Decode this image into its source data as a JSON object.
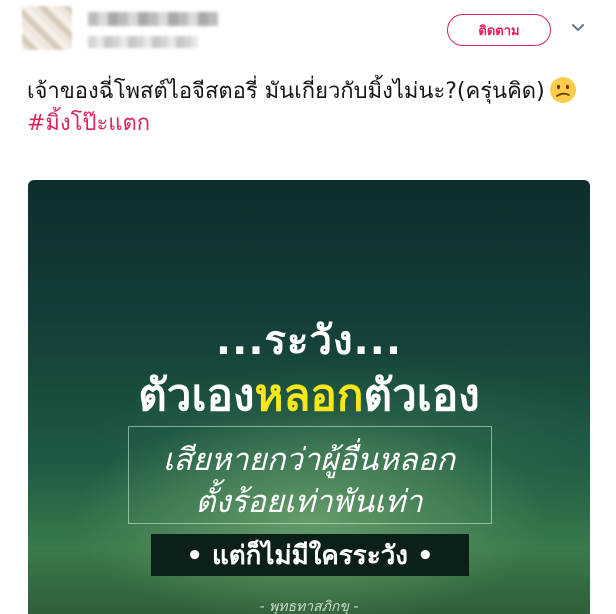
{
  "header": {
    "follow_label": "ติดตาม",
    "more_icon": "chevron-down-icon"
  },
  "tweet": {
    "text": "เจ้าของฉี่โพสต์ไอจีสตอรี่ มันเกี่ยวกับมิ้งไม่นะ?(ครุ่นคิด)",
    "emoji": "confused-face-emoji",
    "hashtag": "#มิ้งโป๊ะแตก"
  },
  "media": {
    "line1": "...ระวัง...",
    "line2_before": "ตัวเอง",
    "line2_highlight": "หลอก",
    "line2_after": "ตัวเอง",
    "line3": "เสียหายกว่าผู้อื่นหลอก",
    "line4": "ตั้งร้อยเท่าพันเท่า",
    "banner": "• แต่ก็ไม่มีใครระวัง •",
    "signature": "- พุทธทาสภิกขุ -",
    "colors": {
      "highlight": "#f6e71b",
      "background": "#14403a"
    }
  },
  "colors": {
    "accent": "#e0245e",
    "text": "#14171a"
  }
}
